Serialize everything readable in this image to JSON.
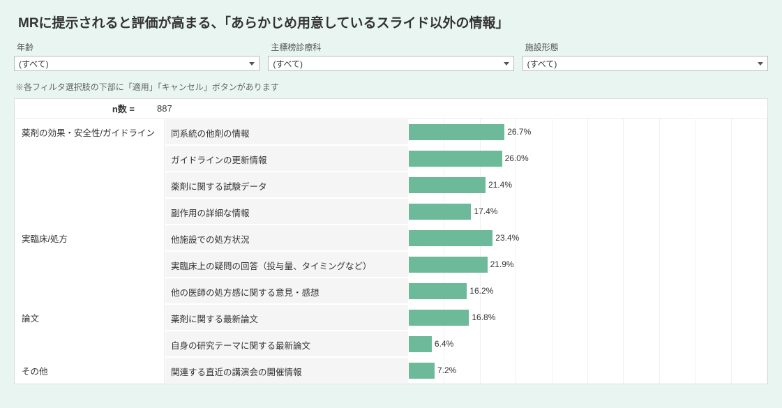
{
  "title": "MRに提示されると評価が高まる、「あらかじめ用意しているスライド以外の情報」",
  "filters": [
    {
      "label": "年齢",
      "value": "(すべて)"
    },
    {
      "label": "主標榜診療科",
      "value": "(すべて)"
    },
    {
      "label": "施設形態",
      "value": "(すべて)"
    }
  ],
  "note": "※各フィルタ選択肢の下部に「適用」「キャンセル」ボタンがあります",
  "n_label": "n数 =",
  "n_value": "887",
  "chart_data": {
    "type": "bar",
    "xlabel": "",
    "ylabel": "",
    "xlim": [
      0,
      100
    ],
    "grid_divisions": 10,
    "bar_color": "#6cba99",
    "groups": [
      {
        "name": "薬剤の効果・安全性/ガイドライン",
        "items": [
          {
            "label": "同系統の他剤の情報",
            "value": 26.7
          },
          {
            "label": "ガイドラインの更新情報",
            "value": 26.0
          },
          {
            "label": "薬剤に関する試験データ",
            "value": 21.4
          },
          {
            "label": "副作用の詳細な情報",
            "value": 17.4
          }
        ]
      },
      {
        "name": "実臨床/処方",
        "items": [
          {
            "label": "他施設での処方状況",
            "value": 23.4
          },
          {
            "label": "実臨床上の疑問の回答（投与量、タイミングなど）",
            "value": 21.9
          },
          {
            "label": "他の医師の処方感に関する意見・感想",
            "value": 16.2
          }
        ]
      },
      {
        "name": "論文",
        "items": [
          {
            "label": "薬剤に関する最新論文",
            "value": 16.8
          },
          {
            "label": "自身の研究テーマに関する最新論文",
            "value": 6.4
          }
        ]
      },
      {
        "name": "その他",
        "items": [
          {
            "label": "関連する直近の講演会の開催情報",
            "value": 7.2
          }
        ]
      }
    ]
  }
}
